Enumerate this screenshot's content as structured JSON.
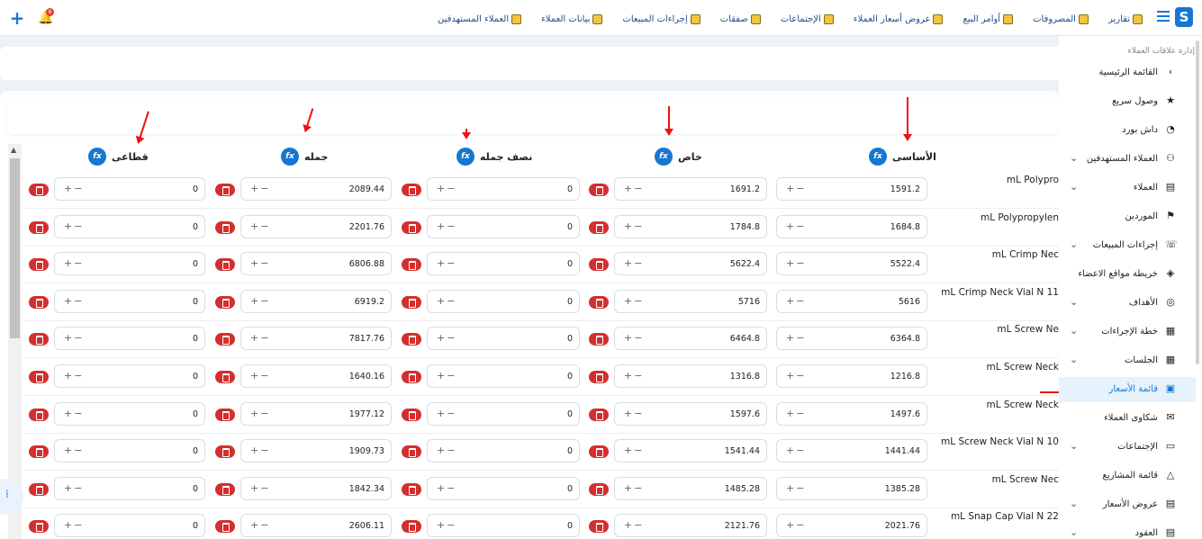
{
  "topbar": {
    "notification_count": "6",
    "nav": [
      {
        "label": "العملاء المستهدفين"
      },
      {
        "label": "بيانات العملاء"
      },
      {
        "label": "إجراءات المبيعات"
      },
      {
        "label": "صفقات"
      },
      {
        "label": "الإجتماعات"
      },
      {
        "label": "عروض أسعار العملاء"
      },
      {
        "label": "أوامر البيع"
      },
      {
        "label": "المصروفات"
      },
      {
        "label": "تقارير"
      }
    ]
  },
  "columns": {
    "basic": "الأساسى",
    "special": "خاص",
    "half_wholesale": "نصف جمله",
    "wholesale": "جمله",
    "retail": "قطاعى",
    "fx": "fx"
  },
  "controls": {
    "plus_minus": "+−"
  },
  "rows": [
    {
      "product": "mL Polypro",
      "basic": "1591.2",
      "special": "1691.2",
      "half": "0",
      "wholesale": "2089.44",
      "retail": "0"
    },
    {
      "product": "mL Polypropylen",
      "basic": "1684.8",
      "special": "1784.8",
      "half": "0",
      "wholesale": "2201.76",
      "retail": "0"
    },
    {
      "product": "mL Crimp Nec",
      "basic": "5522.4",
      "special": "5622.4",
      "half": "0",
      "wholesale": "6806.88",
      "retail": "0"
    },
    {
      "product": "mL Crimp Neck Vial N 11",
      "basic": "5616",
      "special": "5716",
      "half": "0",
      "wholesale": "6919.2",
      "retail": "0"
    },
    {
      "product": "mL Screw Ne",
      "basic": "6364.8",
      "special": "6464.8",
      "half": "0",
      "wholesale": "7817.76",
      "retail": "0"
    },
    {
      "product": "mL Screw Neck",
      "basic": "1216.8",
      "special": "1316.8",
      "half": "0",
      "wholesale": "1640.16",
      "retail": "0"
    },
    {
      "product": "mL Screw Neck",
      "basic": "1497.6",
      "special": "1597.6",
      "half": "0",
      "wholesale": "1977.12",
      "retail": "0"
    },
    {
      "product": "mL Screw Neck Vial N 10",
      "basic": "1441.44",
      "special": "1541.44",
      "half": "0",
      "wholesale": "1909.73",
      "retail": "0"
    },
    {
      "product": "mL Screw Nec",
      "basic": "1385.28",
      "special": "1485.28",
      "half": "0",
      "wholesale": "1842.34",
      "retail": "0"
    },
    {
      "product": "mL Snap Cap Vial N 22",
      "basic": "2021.76",
      "special": "2121.76",
      "half": "0",
      "wholesale": "2606.11",
      "retail": "0"
    }
  ],
  "sidebar": {
    "title": "إدارة علاقات العملاء",
    "items": [
      {
        "label": "القائمة الرئيسية",
        "icon": "chevron-left-icon",
        "chev": ""
      },
      {
        "label": "وصول سريع",
        "icon": "star-icon",
        "chev": ""
      },
      {
        "label": "داش بورد",
        "icon": "gauge-icon",
        "chev": ""
      },
      {
        "label": "العملاء المستهدفين",
        "icon": "users-icon",
        "chev": "⌄"
      },
      {
        "label": "العملاء",
        "icon": "document-icon",
        "chev": "⌄"
      },
      {
        "label": "الموردين",
        "icon": "supplier-icon",
        "chev": ""
      },
      {
        "label": "إجراءات المبيعات",
        "icon": "phone-icon",
        "chev": "⌄"
      },
      {
        "label": "خريطة مواقع الاعضاء",
        "icon": "map-pin-icon",
        "chev": ""
      },
      {
        "label": "الأهداف",
        "icon": "target-icon",
        "chev": "⌄"
      },
      {
        "label": "خطة الإجراءات",
        "icon": "plan-icon",
        "chev": "⌄"
      },
      {
        "label": "الجلسات",
        "icon": "calendar-icon",
        "chev": "⌄"
      },
      {
        "label": "قائمة الأسعار",
        "icon": "price-list-icon",
        "chev": ""
      },
      {
        "label": "شكاوى العملاء",
        "icon": "complaint-icon",
        "chev": ""
      },
      {
        "label": "الإجتماعات",
        "icon": "meeting-icon",
        "chev": "⌄"
      },
      {
        "label": "قائمة المشاريع",
        "icon": "projects-icon",
        "chev": ""
      },
      {
        "label": "عروض الأسعار",
        "icon": "quotes-icon",
        "chev": "⌄"
      },
      {
        "label": "العقود",
        "icon": "contracts-icon",
        "chev": "⌄"
      }
    ]
  },
  "colors": {
    "accent": "#1677d2",
    "danger": "#d32f2f",
    "annotation_arrow": "#e11111",
    "active_bg": "#e6f2fc"
  }
}
